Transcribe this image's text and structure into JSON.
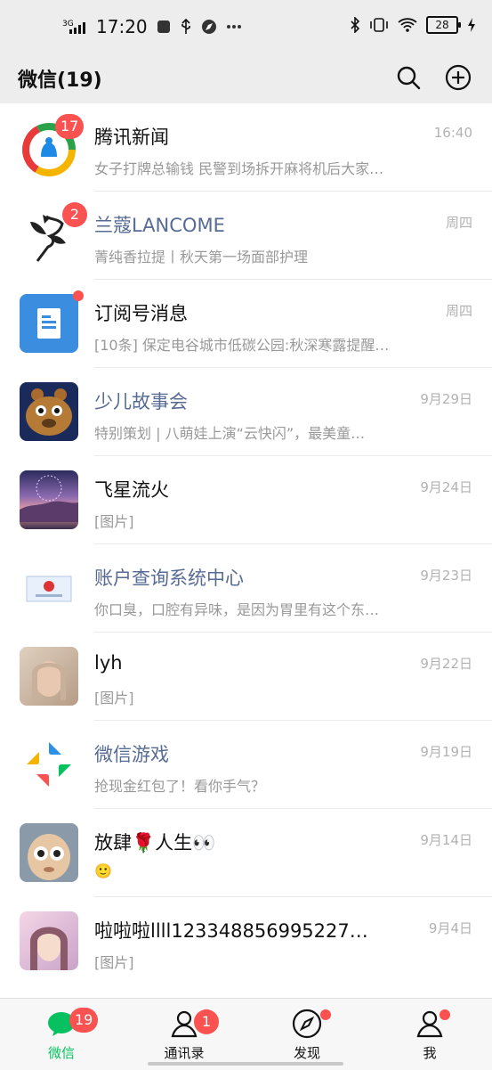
{
  "status_bar": {
    "network": "3G",
    "time": "17:20",
    "battery": "28"
  },
  "header": {
    "title": "微信(19)",
    "search_icon": "search-icon",
    "add_icon": "plus-circle-icon"
  },
  "chats": [
    {
      "name": "腾讯新闻",
      "message": "女子打牌总输钱 民警到场拆开麻将机后大家…",
      "time": "16:40",
      "badge": "17",
      "blue": false
    },
    {
      "name": "兰蔻LANCOME",
      "message": "菁纯香拉提丨秋天第一场面部护理",
      "time": "周四",
      "badge": "2",
      "blue": true
    },
    {
      "name": "订阅号消息",
      "message": "[10条] 保定电谷城市低碳公园:秋深寒露提醒…",
      "time": "周四",
      "dot": true,
      "blue": false
    },
    {
      "name": "少儿故事会",
      "message": "特别策划 | 八萌娃上演“云快闪”，最美童…",
      "time": "9月29日",
      "blue": true
    },
    {
      "name": "飞星流火",
      "message": "[图片]",
      "time": "9月24日",
      "blue": false
    },
    {
      "name": "账户查询系统中心",
      "message": "你口臭，口腔有异味，是因为胃里有这个东…",
      "time": "9月23日",
      "blue": true
    },
    {
      "name": "lyh",
      "message": "[图片]",
      "time": "9月22日",
      "blue": false
    },
    {
      "name": "微信游戏",
      "message": "抢现金红包了！看你手气？",
      "time": "9月19日",
      "blue": true
    },
    {
      "name": "放肆🌹人生👀",
      "message": "🙂",
      "time": "9月14日",
      "blue": false
    },
    {
      "name": "啦啦啦llll123348856995227…",
      "message": "[图片]",
      "time": "9月4日",
      "blue": false
    }
  ],
  "tabbar": {
    "tabs": [
      {
        "label": "微信",
        "badge": "19"
      },
      {
        "label": "通讯录",
        "badge": "1"
      },
      {
        "label": "发现"
      },
      {
        "label": "我"
      }
    ]
  },
  "colors": {
    "accent": "#07c160",
    "badge": "#fa5151",
    "link_name": "#576b95"
  }
}
